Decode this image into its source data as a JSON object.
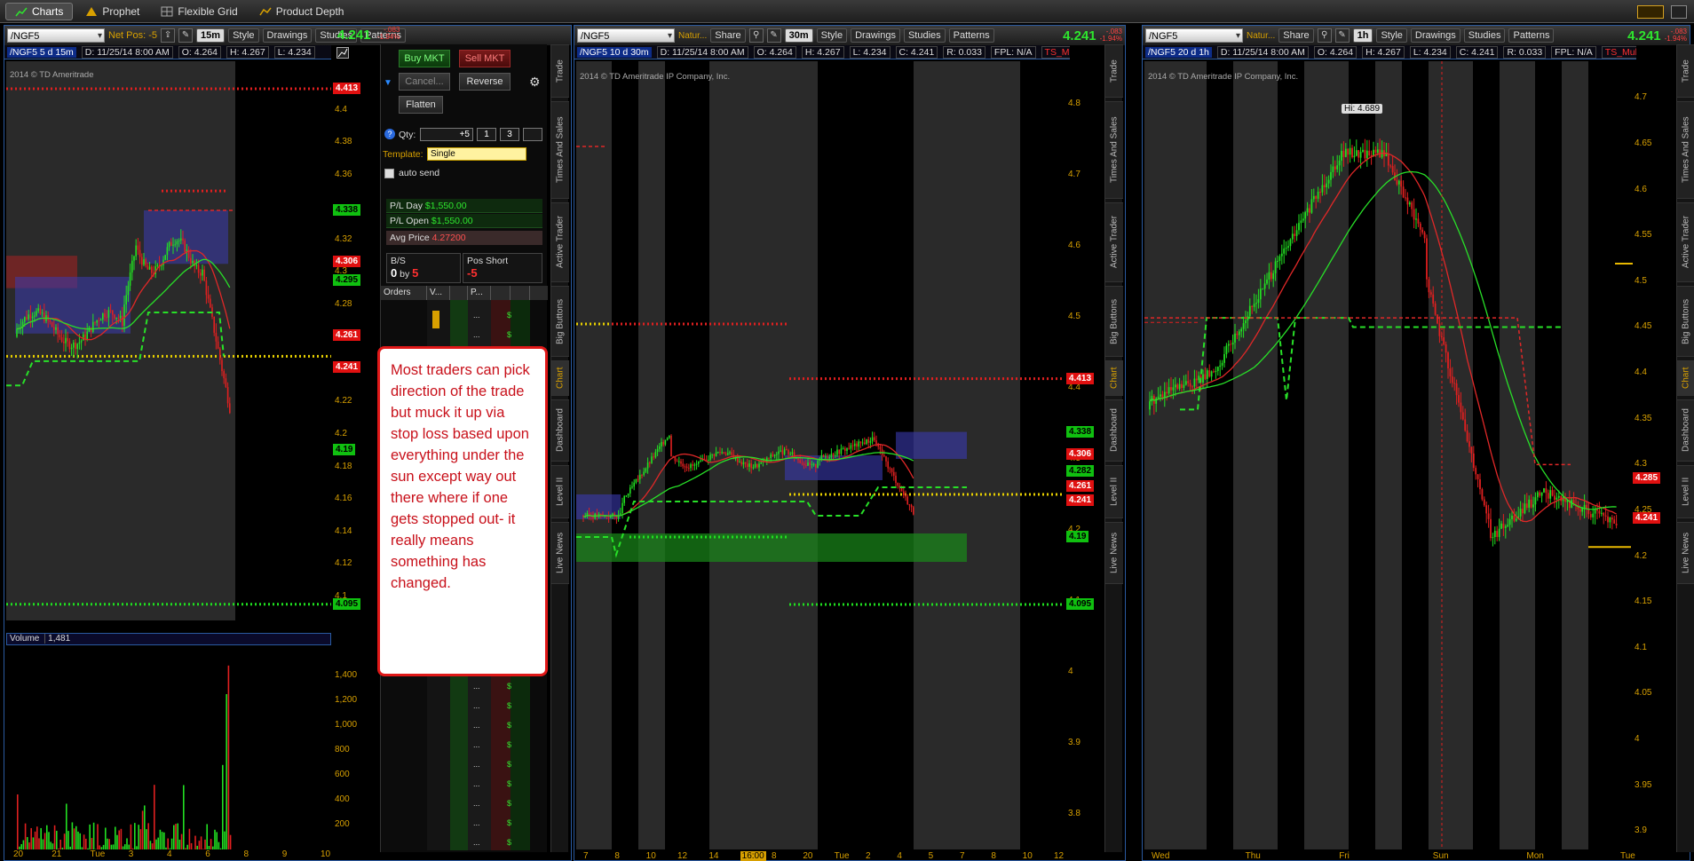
{
  "top_tabs": [
    {
      "label": "Charts",
      "icon": "chart-icon",
      "active": true
    },
    {
      "label": "Prophet",
      "icon": "prophet-icon",
      "active": false
    },
    {
      "label": "Flexible Grid",
      "icon": "grid-icon",
      "active": false
    },
    {
      "label": "Product Depth",
      "icon": "depth-icon",
      "active": false
    }
  ],
  "panel1": {
    "symbol": "/NGF5",
    "net_pos": "Net Pos: -5",
    "timeframe": "15m",
    "style": "Style",
    "drawings": "Drawings",
    "studies": "Studies",
    "patterns": "Patterns",
    "price": "4.241",
    "change": "-.083",
    "change_pct": "-1.94%",
    "info_sym": "/NGF5 5 d 15m",
    "info_d": "D: 11/25/14 8:00 AM",
    "info_o": "O: 4.264",
    "info_h": "H: 4.267",
    "info_l": "L: 4.234",
    "watermark": "2014 © TD Ameritrade",
    "y_ticks": [
      "4.4",
      "4.38",
      "4.36",
      "4.32",
      "4.3",
      "4.28",
      "4.24",
      "4.22",
      "4.2",
      "4.18",
      "4.16",
      "4.14",
      "4.12",
      "4.1"
    ],
    "tags": [
      {
        "text": "4.413",
        "color": "red"
      },
      {
        "text": "4.338",
        "color": "green"
      },
      {
        "text": "4.306",
        "color": "red"
      },
      {
        "text": "4.295",
        "color": "green"
      },
      {
        "text": "4.261",
        "color": "red"
      },
      {
        "text": "4.241",
        "color": "red"
      },
      {
        "text": "4.19",
        "color": "green"
      },
      {
        "text": "4.095",
        "color": "green"
      }
    ],
    "volume_label": "Volume",
    "volume_value": "1,481",
    "vol_ticks": [
      "1,400",
      "1,200",
      "1,000",
      "800",
      "600",
      "400",
      "200"
    ],
    "x_ticks": [
      "20",
      "21",
      "Tue",
      "3",
      "4",
      "6",
      "8",
      "9",
      "10"
    ]
  },
  "active_trader": {
    "buy": "Buy MKT",
    "sell": "Sell MKT",
    "cancel": "Cancel...",
    "reverse": "Reverse",
    "flatten": "Flatten",
    "qty_label": "Qty:",
    "qty_value": "+5",
    "qty_1": "1",
    "qty_3": "3",
    "template_label": "Template:",
    "template_value": "Single",
    "auto_send": "auto send",
    "pl_day_label": "P/L Day",
    "pl_day": "$1,550.00",
    "pl_open_label": "P/L Open",
    "pl_open": "$1,550.00",
    "avg_label": "Avg Price",
    "avg_value": "4.27200",
    "bs_label": "B/S",
    "bs_value_0": "0",
    "bs_by": "by",
    "bs_value_5": "5",
    "pos_label": "Pos Short",
    "pos_value": "-5",
    "orders": "Orders",
    "col_v": "V...",
    "col_p": "P...",
    "dots": "..."
  },
  "callout": "Most traders can pick direction of the trade but muck it up via stop loss based upon everything under the sun except way out there where if one gets stopped out- it really means something has changed.",
  "side_tabs": [
    "Trade",
    "Times And Sales",
    "Active Trader",
    "Big Buttons",
    "Chart",
    "Dashboard",
    "Level II",
    "Live News"
  ],
  "panel2": {
    "symbol": "/NGF5",
    "desc": "Natur...",
    "share": "Share",
    "timeframe": "30m",
    "style": "Style",
    "drawings": "Drawings",
    "studies": "Studies",
    "patterns": "Patterns",
    "price": "4.241",
    "change": "-.083",
    "change_pct": "-1.94%",
    "info_sym": "/NGF5 10 d 30m",
    "info_d": "D: 11/25/14 8:00 AM",
    "info_o": "O: 4.264",
    "info_h": "H: 4.267",
    "info_l": "L: 4.234",
    "info_c": "C: 4.241",
    "info_r": "R: 0.033",
    "info_fpl": "FPL: N/A",
    "info_ts": "TS_Multi...",
    "watermark": "2014 © TD Ameritrade IP Company, Inc.",
    "y_ticks": [
      "4.8",
      "4.7",
      "4.6",
      "4.5",
      "4.4",
      "4.3",
      "4.2",
      "4.1",
      "4",
      "3.9",
      "3.8"
    ],
    "tags": [
      {
        "text": "4.413",
        "color": "red"
      },
      {
        "text": "4.338",
        "color": "green"
      },
      {
        "text": "4.306",
        "color": "red"
      },
      {
        "text": "4.282",
        "color": "green"
      },
      {
        "text": "4.261",
        "color": "red"
      },
      {
        "text": "4.241",
        "color": "red"
      },
      {
        "text": "4.19",
        "color": "green"
      },
      {
        "text": "4.095",
        "color": "green"
      }
    ],
    "x_ticks": [
      "7",
      "8",
      "10",
      "12",
      "14",
      "16:00",
      "8",
      "20",
      "Tue",
      "2",
      "4",
      "5",
      "7",
      "8",
      "10",
      "12"
    ]
  },
  "panel3": {
    "symbol": "/NGF5",
    "desc": "Natur...",
    "share": "Share",
    "timeframe": "1h",
    "style": "Style",
    "drawings": "Drawings",
    "studies": "Studies",
    "patterns": "Patterns",
    "price": "4.241",
    "change": "-.083",
    "change_pct": "-1.94%",
    "info_sym": "/NGF5 20 d 1h",
    "info_d": "D: 11/25/14 8:00 AM",
    "info_o": "O: 4.264",
    "info_h": "H: 4.267",
    "info_l": "L: 4.234",
    "info_c": "C: 4.241",
    "info_r": "R: 0.033",
    "info_fpl": "FPL: N/A",
    "info_ts": "TS_Multi...",
    "watermark": "2014 © TD Ameritrade IP Company, Inc.",
    "hi_label": "Hi: 4.689",
    "y_ticks": [
      "4.7",
      "4.65",
      "4.6",
      "4.55",
      "4.5",
      "4.45",
      "4.4",
      "4.35",
      "4.3",
      "4.25",
      "4.2",
      "4.15",
      "4.1",
      "4.05",
      "4",
      "3.95",
      "3.9"
    ],
    "tags": [
      {
        "text": "4.285",
        "color": "red"
      },
      {
        "text": "4.241",
        "color": "red"
      }
    ],
    "x_ticks": [
      "Wed",
      "Thu",
      "Fri",
      "Sun",
      "Mon",
      "Tue"
    ]
  },
  "colors": {
    "up": "#22e022",
    "down": "#e02020",
    "axis": "#d8a000",
    "accent": "#2a5aa0"
  }
}
